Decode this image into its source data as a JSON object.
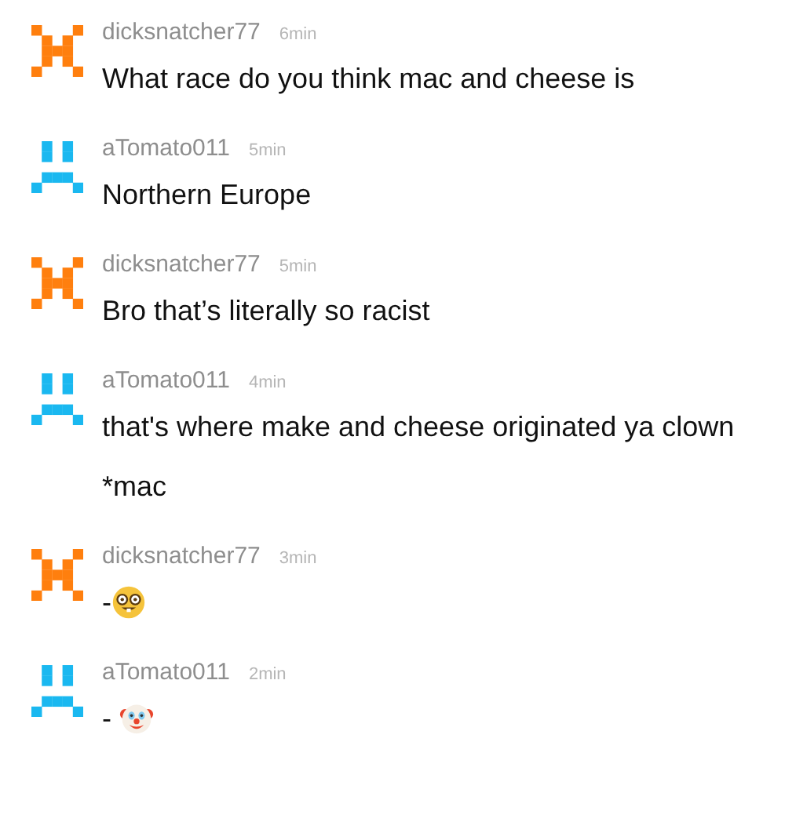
{
  "posts": [
    {
      "user": "dicksnatcher77",
      "time": "6min",
      "avatar": {
        "kind": "h",
        "color": "#ff7f0e"
      },
      "lines": [
        {
          "text": "What race do you think mac and cheese is"
        }
      ]
    },
    {
      "user": "aTomato011",
      "time": "5min",
      "avatar": {
        "kind": "frown",
        "color": "#1ab8f0"
      },
      "lines": [
        {
          "text": "Northern Europe"
        }
      ]
    },
    {
      "user": "dicksnatcher77",
      "time": "5min",
      "avatar": {
        "kind": "h",
        "color": "#ff7f0e"
      },
      "lines": [
        {
          "text": "Bro that’s literally so racist"
        }
      ]
    },
    {
      "user": "aTomato011",
      "time": "4min",
      "avatar": {
        "kind": "frown",
        "color": "#1ab8f0"
      },
      "lines": [
        {
          "text": "that's where make and cheese originated ya clown"
        },
        {
          "text": "*mac"
        }
      ]
    },
    {
      "user": "dicksnatcher77",
      "time": "3min",
      "avatar": {
        "kind": "h",
        "color": "#ff7f0e"
      },
      "lines": [
        {
          "text": "-",
          "kind": "nerd"
        }
      ]
    },
    {
      "user": "aTomato011",
      "time": "2min",
      "avatar": {
        "kind": "frown",
        "color": "#1ab8f0"
      },
      "lines": [
        {
          "text": "- ",
          "kind": "clown"
        }
      ]
    }
  ]
}
